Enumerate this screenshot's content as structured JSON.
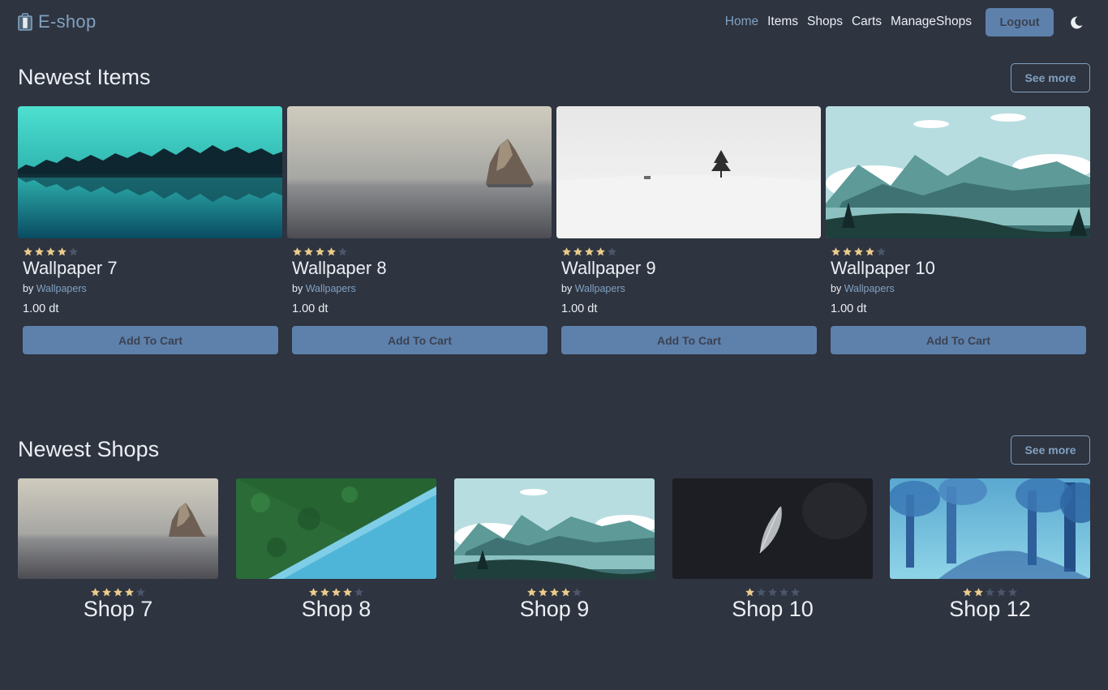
{
  "brand": {
    "name": "E-shop"
  },
  "nav": {
    "links": [
      "Home",
      "Items",
      "Shops",
      "Carts",
      "ManageShops"
    ],
    "active": "Home",
    "logout_label": "Logout"
  },
  "colors": {
    "background": "#2e3440",
    "accent": "#81a1c1",
    "button": "#5e81ac",
    "star_filled": "#ebcb8b",
    "star_empty": "#4c566a"
  },
  "icons": {
    "brand": "shopping-bag-icon",
    "theme": "moon-icon",
    "rating": "star-icon"
  },
  "newest_items": {
    "title": "Newest Items",
    "see_more": "See more",
    "items": [
      {
        "name": "Wallpaper 7",
        "by": "by",
        "shop": "Wallpapers",
        "price": "1.00 dt",
        "rating": 4,
        "button": "Add To Cart",
        "image": "teal-lake-trees"
      },
      {
        "name": "Wallpaper 8",
        "by": "by",
        "shop": "Wallpapers",
        "price": "1.00 dt",
        "rating": 4,
        "button": "Add To Cart",
        "image": "grey-sea-rock"
      },
      {
        "name": "Wallpaper 9",
        "by": "by",
        "shop": "Wallpapers",
        "price": "1.00 dt",
        "rating": 4,
        "button": "Add To Cart",
        "image": "snow-lone-tree"
      },
      {
        "name": "Wallpaper 10",
        "by": "by",
        "shop": "Wallpapers",
        "price": "1.00 dt",
        "rating": 4,
        "button": "Add To Cart",
        "image": "mountain-illustration"
      }
    ]
  },
  "newest_shops": {
    "title": "Newest Shops",
    "see_more": "See more",
    "shops": [
      {
        "name": "Shop 7",
        "rating": 4,
        "image": "grey-sea-rock"
      },
      {
        "name": "Shop 8",
        "rating": 4,
        "image": "forest-river-aerial"
      },
      {
        "name": "Shop 9",
        "rating": 4,
        "image": "mountain-illustration"
      },
      {
        "name": "Shop 10",
        "rating": 1,
        "image": "dark-feather"
      },
      {
        "name": "Shop 12",
        "rating": 2,
        "image": "blue-forest-painting"
      }
    ]
  }
}
